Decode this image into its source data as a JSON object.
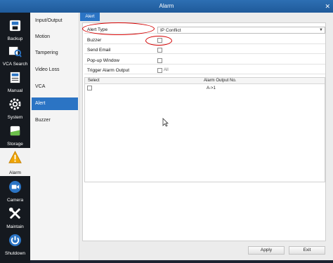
{
  "window": {
    "title": "Alarm",
    "close_glyph": "✕"
  },
  "rail": {
    "items": [
      {
        "label": "Backup",
        "icon": "backup-icon"
      },
      {
        "label": "VCA Search",
        "icon": "camera-search-icon"
      },
      {
        "label": "Manual",
        "icon": "manual-book-icon"
      },
      {
        "label": "System",
        "icon": "gear-icon"
      },
      {
        "label": "Storage",
        "icon": "storage-icon"
      },
      {
        "label": "Alarm",
        "icon": "warning-icon"
      },
      {
        "label": "Camera",
        "icon": "camera-icon"
      },
      {
        "label": "Maintain",
        "icon": "tools-icon"
      },
      {
        "label": "Shutdown",
        "icon": "power-icon"
      }
    ],
    "active": "Alarm"
  },
  "submenu": {
    "items": [
      "Input/Output",
      "Motion",
      "Tampering",
      "Video Loss",
      "VCA",
      "Alert",
      "Buzzer"
    ],
    "active": "Alert"
  },
  "tab": {
    "label": "Alert"
  },
  "form": {
    "alert_type_label": "Alert Type",
    "alert_type_value": "IP Conflict",
    "buzzer_label": "Buzzer",
    "send_email_label": "Send Email",
    "popup_label": "Pop-up Window",
    "trigger_label": "Trigger Alarm Output",
    "trigger_all": "All"
  },
  "table": {
    "headers": [
      "Select",
      "Alarm Output No."
    ],
    "rows": [
      {
        "output": "A->1"
      }
    ]
  },
  "buttons": {
    "apply": "Apply",
    "exit": "Exit"
  },
  "colors": {
    "accent": "#2b74c4",
    "annotation": "#d40000",
    "rail_bg": "#15191f"
  }
}
